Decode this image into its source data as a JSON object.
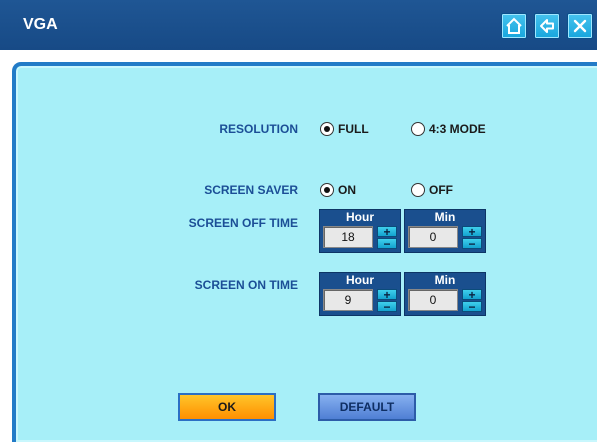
{
  "window": {
    "title": "VGA"
  },
  "toolbar": {
    "home_icon": "home-icon",
    "back_icon": "back-arrow-icon",
    "close_icon": "close-icon"
  },
  "resolution": {
    "label": "RESOLUTION",
    "options": [
      {
        "label": "FULL",
        "selected": true
      },
      {
        "label": "4:3 MODE",
        "selected": false
      }
    ]
  },
  "screen_saver": {
    "label": "SCREEN SAVER",
    "options": [
      {
        "label": "ON",
        "selected": true
      },
      {
        "label": "OFF",
        "selected": false
      }
    ]
  },
  "screen_off_time": {
    "label": "SCREEN OFF TIME",
    "hour": {
      "header": "Hour",
      "value": "18"
    },
    "min": {
      "header": "Min",
      "value": "0"
    }
  },
  "screen_on_time": {
    "label": "SCREEN ON TIME",
    "hour": {
      "header": "Hour",
      "value": "9"
    },
    "min": {
      "header": "Min",
      "value": "0"
    }
  },
  "spin_symbols": {
    "plus": "+",
    "minus": "−"
  },
  "buttons": {
    "ok": "OK",
    "default": "DEFAULT"
  },
  "colors": {
    "title_bar": "#1f5694",
    "panel": "#a7eff8",
    "label_text": "#1b4e96",
    "ok_button": "#ff9f00",
    "default_button": "#6a98e4"
  }
}
